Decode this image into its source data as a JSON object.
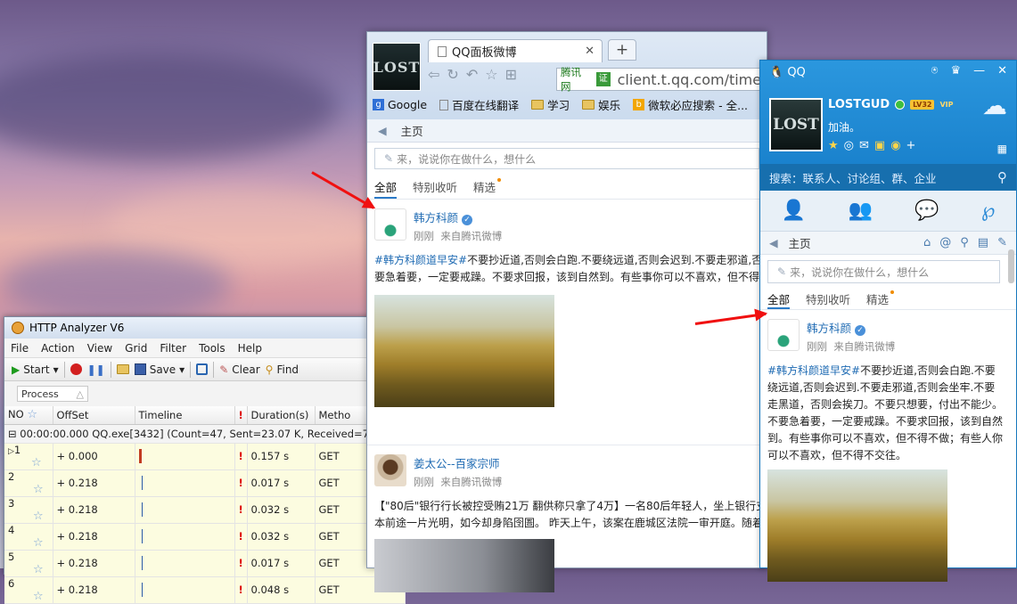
{
  "http_analyzer": {
    "title": "HTTP Analyzer V6",
    "menu": [
      "File",
      "Action",
      "View",
      "Grid",
      "Filter",
      "Tools",
      "Help"
    ],
    "toolbar": {
      "start": "Start",
      "save": "Save",
      "clear": "Clear",
      "find": "Find"
    },
    "filter_label": "Process",
    "columns": [
      "NO",
      "OffSet",
      "Timeline",
      "Duration(s)",
      "Metho"
    ],
    "group_row": "00:00:00.000   QQ.exe[3432]  (Count=47, Sent=23.07 K, Received=79.46 K,",
    "rows": [
      {
        "no": "1",
        "offset": "+ 0.000",
        "duration": "0.157 s",
        "method": "GET"
      },
      {
        "no": "2",
        "offset": "+ 0.218",
        "duration": "0.017 s",
        "method": "GET"
      },
      {
        "no": "3",
        "offset": "+ 0.218",
        "duration": "0.032 s",
        "method": "GET"
      },
      {
        "no": "4",
        "offset": "+ 0.218",
        "duration": "0.032 s",
        "method": "GET"
      },
      {
        "no": "5",
        "offset": "+ 0.218",
        "duration": "0.017 s",
        "method": "GET"
      },
      {
        "no": "6",
        "offset": "+ 0.218",
        "duration": "0.048 s",
        "method": "GET"
      }
    ]
  },
  "browser": {
    "avatar_text": "LOST",
    "tab_title": "QQ面板微博",
    "new_tab": "+",
    "address_site": "腾讯网",
    "address_cert": "证",
    "address_url": "client.t.qq.com/timeli",
    "bookmarks": [
      "Google",
      "百度在线翻译",
      "学习",
      "娱乐",
      "微软必应搜索 - 全..."
    ],
    "nav": "主页",
    "compose_placeholder": "来，说说你在做什么，想什么",
    "feed_tabs": [
      "全部",
      "特别收听",
      "精选"
    ],
    "post1": {
      "name": "韩方科颜",
      "time": "刚刚",
      "source": "来自腾讯微博",
      "tag": "#韩方科颜道早安#",
      "text": "不要抄近道,否则会白跑.不要绕远道,否则会迟到.不要走邪道,否",
      "text2": "要急着要，一定要戒躁。不要求回报，该到自然到。有些事你可以不喜欢，但不得"
    },
    "post2": {
      "name": "姜太公--百家宗师",
      "time": "刚刚",
      "source": "来自腾讯微博",
      "text": "【\"80后\"银行行长被控受贿21万 翻供称只拿了4万】一名80后年轻人，坐上银行支",
      "text2": "本前途一片光明，如今却身陷囹圄。 昨天上午，该案在鹿城区法院一审开庭。随着"
    }
  },
  "qq": {
    "brand": "QQ",
    "username": "LOSTGUD",
    "level": "LV32",
    "vip": "VIP",
    "signature": "加油。",
    "avatar_text": "LOST",
    "search_placeholder": "搜索：联系人、讨论组、群、企业",
    "nav": "主页",
    "compose_placeholder": "来，说说你在做什么，想什么",
    "feed_tabs": [
      "全部",
      "特别收听",
      "精选"
    ],
    "post": {
      "name": "韩方科颜",
      "time": "刚刚",
      "source": "来自腾讯微博",
      "tag": "#韩方科颜道早安#",
      "text": "不要抄近道,否则会白跑.不要绕远道,否则会迟到.不要走邪道,否则会坐牢.不要走黑道，否则会挨刀。不要只想要，付出不能少。不要急着要，一定要戒躁。不要求回报，该到自然到。有些事你可以不喜欢，但不得不做；有些人你可以不喜欢，但不得不交往。"
    }
  }
}
